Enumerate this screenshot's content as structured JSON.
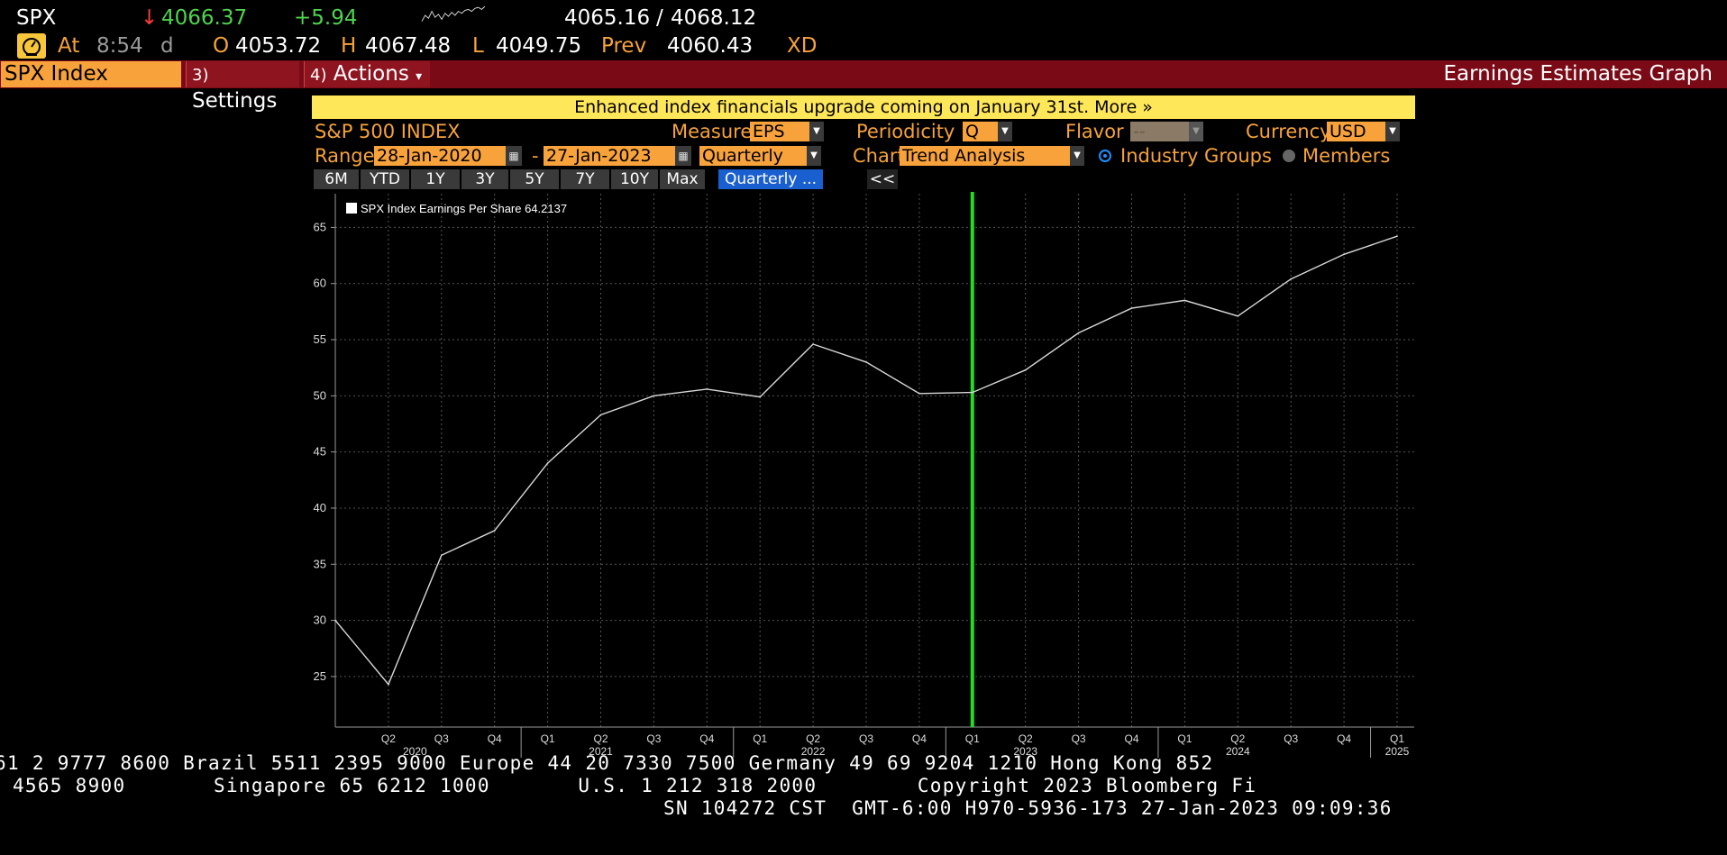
{
  "header": {
    "symbol": "SPX",
    "arrow": "↓",
    "last": "4066.37",
    "change": "+5.94",
    "bid": "4065.16",
    "slash": "/",
    "ask": "4068.12",
    "at_label": "At",
    "time": "8:54",
    "time_suffix": "d",
    "open_label": "O",
    "open": "4053.72",
    "high_label": "H",
    "high": "4067.48",
    "low_label": "L",
    "low": "4049.75",
    "prev_label": "Prev",
    "prev": "4060.43",
    "xd": "XD",
    "spark_points": [
      0.2,
      0.5,
      0.35,
      0.7,
      0.4,
      0.55,
      0.3,
      0.6,
      0.45,
      0.65,
      0.5,
      0.7,
      0.6,
      0.75,
      0.8,
      0.7,
      0.85,
      0.9,
      0.8,
      0.95
    ]
  },
  "menubar": {
    "ticker": "SPX Index",
    "settings_num": "3)",
    "settings": "Settings",
    "actions_num": "4)",
    "actions": "Actions",
    "actions_caret": "▾",
    "function_title": "Earnings Estimates Graph"
  },
  "banner": "Enhanced index financials upgrade coming on January 31st. More »",
  "controls": {
    "index_name": "S&P 500 INDEX",
    "measure_label": "Measure",
    "measure_value": "EPS",
    "periodicity_label": "Periodicity",
    "periodicity_value": "Q",
    "flavor_label": "Flavor",
    "flavor_value": "--",
    "currency_label": "Currency",
    "currency_value": "USD",
    "range_label": "Range",
    "range_start": "28-Jan-2020",
    "range_dash": "-",
    "range_end": "27-Jan-2023",
    "range_period": "Quarterly",
    "chart_label": "Chart",
    "chart_value": "Trend Analysis",
    "radio_industry": "Industry Groups",
    "radio_members": "Members",
    "range_buttons": [
      "6M",
      "YTD",
      "1Y",
      "3Y",
      "5Y",
      "7Y",
      "10Y",
      "Max"
    ],
    "quarterly_button": "Quarterly ...",
    "collapse": "<<"
  },
  "colors": {
    "accent": "#f7a23b",
    "menubar": "#7b0a17",
    "banner": "#ffe75a",
    "positive": "#4fd34f",
    "negative": "#ff3b3b",
    "active_button": "#1a5fd0",
    "current_marker": "#22dd22"
  },
  "chart_data": {
    "type": "line",
    "legend": "SPX Index Earnings Per Share 64.2137",
    "series": [
      {
        "name": "SPX Index Earnings Per Share",
        "values": [
          30.0,
          24.3,
          35.8,
          38.0,
          44.0,
          48.3,
          50.0,
          50.6,
          49.9,
          54.6,
          53.0,
          50.2,
          50.3,
          52.3,
          55.6,
          57.8,
          58.5,
          57.1,
          60.4,
          62.6,
          64.2137
        ]
      }
    ],
    "quarter_labels": [
      "",
      "Q2",
      "Q3",
      "Q4",
      "Q1",
      "Q2",
      "Q3",
      "Q4",
      "Q1",
      "Q2",
      "Q3",
      "Q4",
      "Q1",
      "Q2",
      "Q3",
      "Q4",
      "Q1",
      "Q2",
      "Q3",
      "Q4",
      "Q1"
    ],
    "year_labels": [
      {
        "index": 1.5,
        "label": "2020"
      },
      {
        "index": 5,
        "label": "2021"
      },
      {
        "index": 9,
        "label": "2022"
      },
      {
        "index": 13,
        "label": "2023"
      },
      {
        "index": 17,
        "label": "2024"
      },
      {
        "index": 20,
        "label": "2025"
      }
    ],
    "year_dividers": [
      3,
      7,
      11,
      15,
      19
    ],
    "current_index": 12,
    "y_ticks": [
      25,
      30,
      35,
      40,
      45,
      50,
      55,
      60,
      65
    ],
    "ylim": [
      20.5,
      68
    ],
    "grid": true,
    "legend_position": "top-left"
  },
  "footer": {
    "line1": "61 2 9777 8600 Brazil 5511 2395 9000 Europe 44 20 7330 7500 Germany 49 69 9204 1210 Hong Kong 852",
    "line2": " 4565 8900       Singapore 65 6212 1000       U.S. 1 212 318 2000        Copyright 2023 Bloomberg Fi",
    "line3": "SN 104272 CST  GMT-6:00 H970-5936-173 27-Jan-2023 09:09:36"
  }
}
